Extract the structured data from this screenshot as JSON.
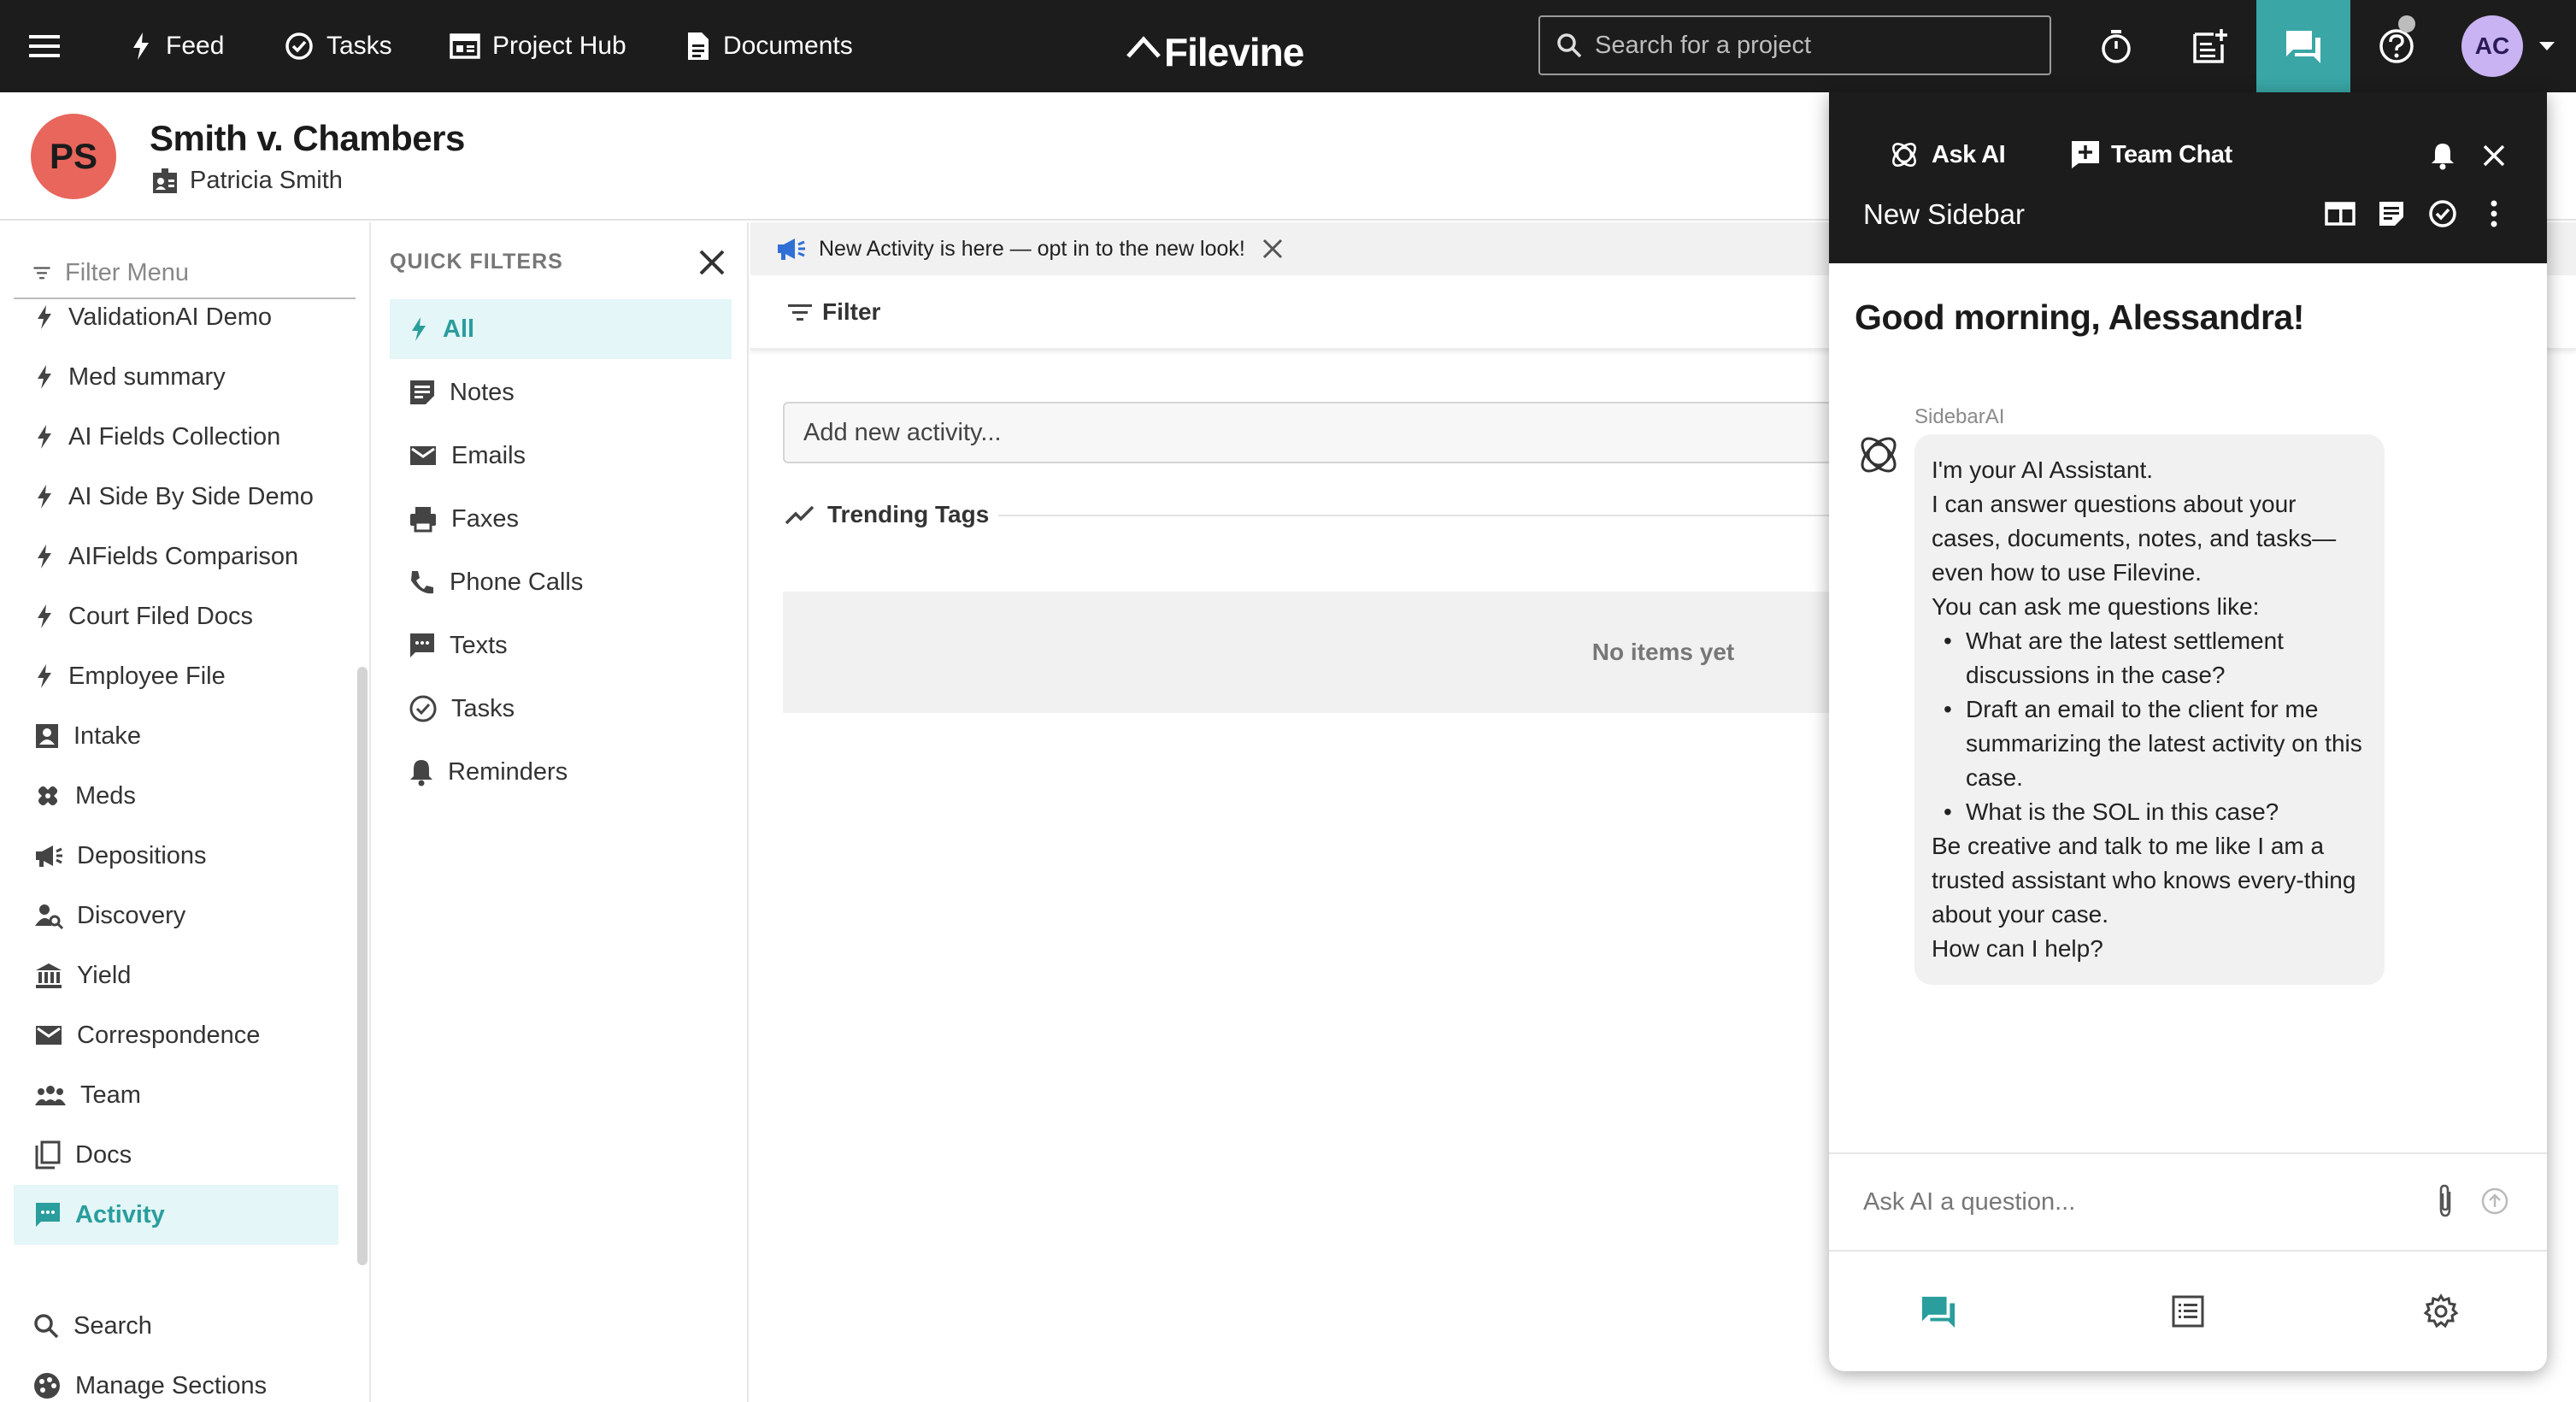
{
  "colors": {
    "topbar_bg": "#1c1c1c",
    "accent_teal": "#3aa6a6",
    "active_item_bg": "#e4f6f7",
    "project_avatar_bg": "#e8665c",
    "user_avatar_bg": "#c9b3f2"
  },
  "topbar": {
    "nav": [
      {
        "label": "Feed",
        "icon": "lightning-icon"
      },
      {
        "label": "Tasks",
        "icon": "check-circle-icon"
      },
      {
        "label": "Project Hub",
        "icon": "project-hub-icon"
      },
      {
        "label": "Documents",
        "icon": "document-icon"
      }
    ],
    "logo_text": "Filevine",
    "search_placeholder": "Search for a project",
    "user_initials": "AC"
  },
  "project": {
    "initials": "PS",
    "title": "Smith v. Chambers",
    "client": "Patricia Smith"
  },
  "left_menu": {
    "filter_placeholder": "Filter Menu",
    "items": [
      {
        "label": "ValidationAI Demo",
        "icon": "lightning-icon"
      },
      {
        "label": "Med summary",
        "icon": "lightning-icon"
      },
      {
        "label": "AI Fields Collection",
        "icon": "lightning-icon"
      },
      {
        "label": "AI Side By Side Demo",
        "icon": "lightning-icon"
      },
      {
        "label": "AIFields Comparison",
        "icon": "lightning-icon"
      },
      {
        "label": "Court Filed Docs",
        "icon": "lightning-icon"
      },
      {
        "label": "Employee File",
        "icon": "lightning-icon"
      },
      {
        "label": "Intake",
        "icon": "contact-card-icon"
      },
      {
        "label": "Meds",
        "icon": "bandage-icon"
      },
      {
        "label": "Depositions",
        "icon": "megaphone-icon"
      },
      {
        "label": "Discovery",
        "icon": "person-search-icon"
      },
      {
        "label": "Yield",
        "icon": "bank-icon"
      },
      {
        "label": "Correspondence",
        "icon": "envelope-icon"
      },
      {
        "label": "Team",
        "icon": "people-icon"
      },
      {
        "label": "Docs",
        "icon": "copy-icon"
      },
      {
        "label": "Activity",
        "icon": "chat-dots-icon",
        "active": true
      }
    ],
    "bottom": [
      {
        "label": "Search",
        "icon": "search-icon"
      },
      {
        "label": "Manage Sections",
        "icon": "palette-icon"
      }
    ]
  },
  "quick_filters": {
    "title": "QUICK FILTERS",
    "items": [
      {
        "label": "All",
        "icon": "lightning-icon",
        "active": true
      },
      {
        "label": "Notes",
        "icon": "note-icon"
      },
      {
        "label": "Emails",
        "icon": "envelope-icon"
      },
      {
        "label": "Faxes",
        "icon": "printer-icon"
      },
      {
        "label": "Phone Calls",
        "icon": "phone-icon"
      },
      {
        "label": "Texts",
        "icon": "text-message-icon"
      },
      {
        "label": "Tasks",
        "icon": "check-circle-icon"
      },
      {
        "label": "Reminders",
        "icon": "bell-icon"
      }
    ]
  },
  "main": {
    "banner_text": "New Activity is here — opt in to the new look!",
    "filter_label": "Filter",
    "add_activity_placeholder": "Add new activity...",
    "trending_label": "Trending Tags",
    "empty_text": "No items yet"
  },
  "sidebar": {
    "tab_ask_ai": "Ask AI",
    "tab_team_chat": "Team Chat",
    "title": "New Sidebar",
    "greeting": "Good morning, Alessandra!",
    "ai_name": "SidebarAI",
    "message": {
      "intro": [
        "I'm your AI Assistant.",
        "I can answer questions about your cases, documents, notes, and tasks—even how to use Filevine.",
        "You can ask me questions like:"
      ],
      "examples": [
        "What are the latest settlement discussions in the case?",
        "Draft an email to the client for me summarizing the latest activity on this case.",
        "What is the SOL in this case?"
      ],
      "outro": [
        "Be creative and talk to me like I am a trusted assistant who knows every-thing about your case.",
        "How can I help?"
      ]
    },
    "ask_placeholder": "Ask AI a question..."
  }
}
